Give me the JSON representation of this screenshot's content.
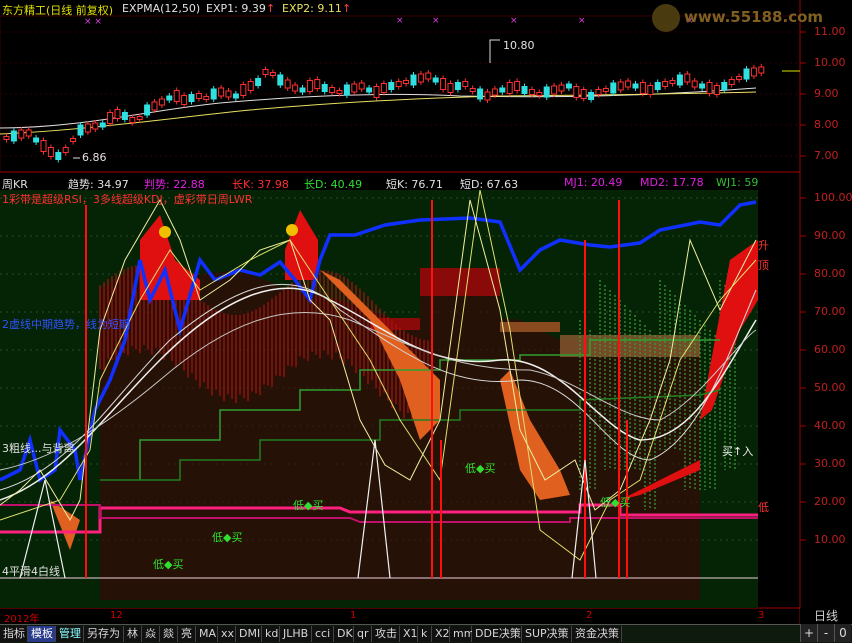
{
  "header": {
    "stock": "东方精工(日线 前复权)",
    "indicator": "EXPMA(12,50)",
    "exp1_label": "EXP1: 9.39",
    "exp2_label": "EXP2: 9.11",
    "watermark": "www.55188.com"
  },
  "price_axis": [
    "11.00",
    "10.00",
    "9.00",
    "8.00",
    "7.00"
  ],
  "price_annotations": {
    "high": "10.80",
    "low": "6.86"
  },
  "lower_header": {
    "name": "周KR",
    "trend": "趋势: 34.97",
    "judge": "判势: 22.88",
    "longk": "长K: 37.98",
    "longd": "长D: 40.49",
    "shortk": "短K: 76.71",
    "shortd": "短D: 67.63",
    "mj1": "MJ1: 20.49",
    "md2": "MD2: 17.78",
    "wj1": "WJ1: 59"
  },
  "lower_axis": [
    "100.00",
    "90.00",
    "80.00",
    "70.00",
    "60.00",
    "50.00",
    "40.00",
    "30.00",
    "20.00",
    "10.00"
  ],
  "annotations": {
    "line1": "1彩带是超级RSI，3多线超级KDJ，虚彩带日周LWR",
    "line2": "2虚线中期趋势，线为短期",
    "line3": "3粗线...与背离",
    "line4": "4平滑4白线",
    "buy_low": "低◆买",
    "buy_in": "买↑入",
    "rise_top": "升顶",
    "low": "低"
  },
  "x_axis": [
    "2012年",
    "12",
    "1",
    "2",
    "3"
  ],
  "period": "日线",
  "toolbar": [
    "指标",
    "模板",
    "管理",
    "另存为",
    "林",
    "焱",
    "燚",
    "亮",
    "MA",
    "xx",
    "DMI",
    "kd",
    "JLHB",
    "cci",
    "DK",
    "qr",
    "攻击",
    "X1",
    "k",
    "X2",
    "mm",
    "DDE决策",
    "SUP决策",
    "资金决策"
  ],
  "toolbar_right": [
    "+",
    "-",
    "0"
  ],
  "colors": {
    "up": "#ff3030",
    "down": "#30e0e0",
    "bg": "#000000",
    "blue_line": "#1030ff",
    "pink": "#ff2080"
  }
}
